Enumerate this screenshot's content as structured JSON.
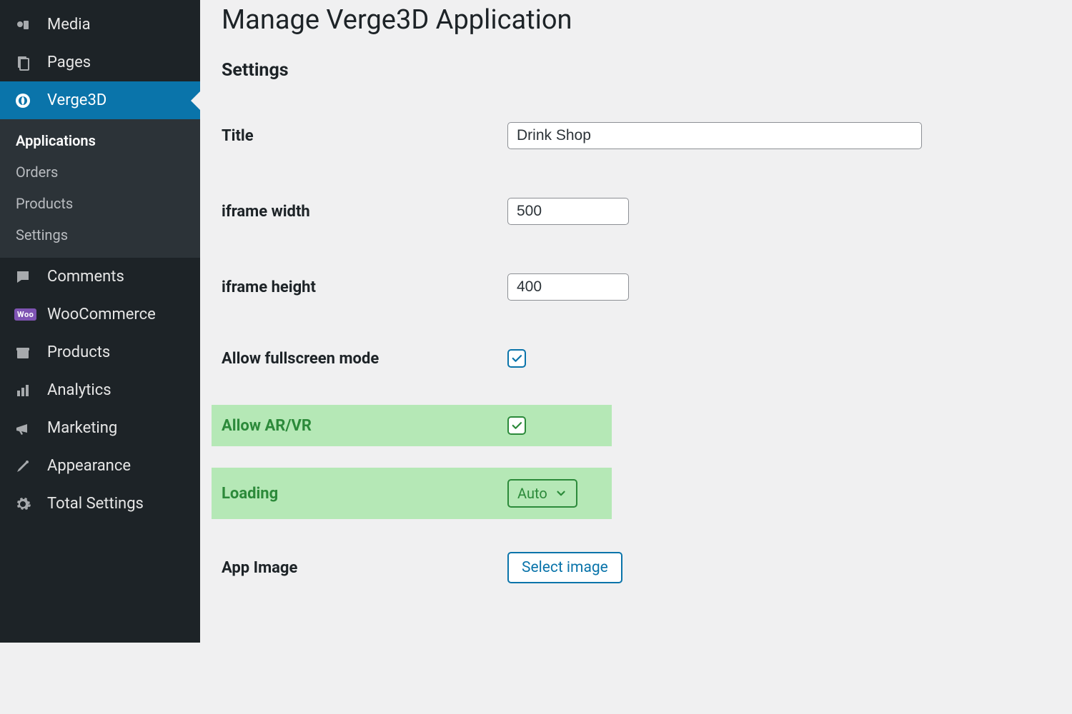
{
  "sidebar": {
    "items": [
      {
        "id": "media",
        "label": "Media"
      },
      {
        "id": "pages",
        "label": "Pages"
      },
      {
        "id": "verge3d",
        "label": "Verge3D",
        "active": true
      },
      {
        "id": "comments",
        "label": "Comments"
      },
      {
        "id": "woocommerce",
        "label": "WooCommerce"
      },
      {
        "id": "products",
        "label": "Products"
      },
      {
        "id": "analytics",
        "label": "Analytics"
      },
      {
        "id": "marketing",
        "label": "Marketing"
      },
      {
        "id": "appearance",
        "label": "Appearance"
      },
      {
        "id": "total-settings",
        "label": "Total Settings"
      }
    ],
    "verge3d_sub": [
      {
        "id": "applications",
        "label": "Applications",
        "current": true
      },
      {
        "id": "orders",
        "label": "Orders"
      },
      {
        "id": "products",
        "label": "Products"
      },
      {
        "id": "settings",
        "label": "Settings"
      }
    ],
    "woo_badge": "Woo"
  },
  "page": {
    "title": "Manage Verge3D Application",
    "section": "Settings"
  },
  "form": {
    "title_label": "Title",
    "title_value": "Drink Shop",
    "iframe_width_label": "iframe width",
    "iframe_width_value": "500",
    "iframe_height_label": "iframe height",
    "iframe_height_value": "400",
    "fullscreen_label": "Allow fullscreen mode",
    "arvr_label": "Allow AR/VR",
    "loading_label": "Loading",
    "loading_value": "Auto",
    "app_image_label": "App Image",
    "select_image_label": "Select image"
  }
}
